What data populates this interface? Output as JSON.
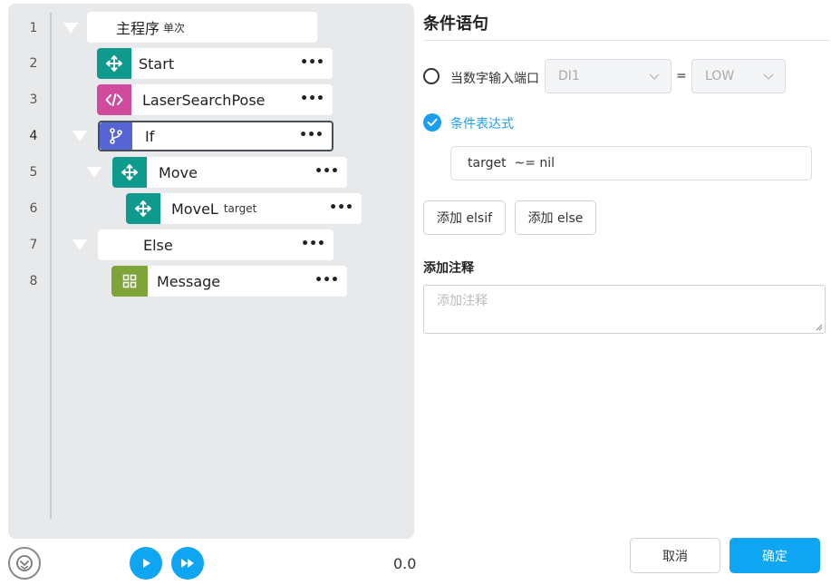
{
  "editor": {
    "line_numbers": [
      "1",
      "2",
      "3",
      "4",
      "5",
      "6",
      "7",
      "8"
    ],
    "nodes": {
      "main": {
        "label": "主程序",
        "sub": "单次"
      },
      "start": {
        "label": "Start",
        "icon": "move-icon"
      },
      "laser": {
        "label": "LaserSearchPose",
        "icon": "code-icon"
      },
      "if_node": {
        "label": "If",
        "icon": "branch-icon"
      },
      "move": {
        "label": "Move",
        "icon": "move-icon"
      },
      "movel": {
        "label": "MoveL",
        "sub": "target",
        "icon": "move-icon"
      },
      "else_node": {
        "label": "Else"
      },
      "message": {
        "label": "Message",
        "icon": "grid-icon"
      }
    },
    "menu_dots": "•••",
    "time_value": "0.0"
  },
  "panel": {
    "title": "条件语句",
    "option1": {
      "label": "当数字输入端口",
      "port_value": "DI1",
      "equals": "=",
      "level_value": "LOW"
    },
    "option2": {
      "label": "条件表达式",
      "expression": "target  ~= nil"
    },
    "buttons": {
      "add_elsif": "添加 elsif",
      "add_else": "添加 else"
    },
    "comment": {
      "heading": "添加注释",
      "placeholder": "添加注释"
    },
    "footer": {
      "cancel": "取消",
      "confirm": "确定"
    }
  },
  "colors": {
    "teal": "#0f9a8e",
    "pink": "#d04b9e",
    "indigo": "#5565d6",
    "olive": "#7ea43a",
    "primary": "#0ea5f2"
  }
}
